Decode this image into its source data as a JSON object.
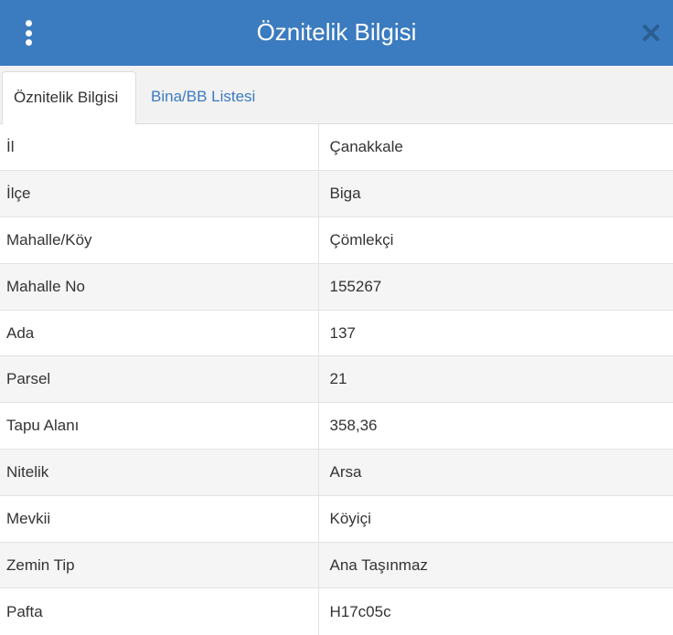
{
  "header": {
    "title": "Öznitelik Bilgisi",
    "menu_icon": "vertical-dots-icon",
    "close_icon": "close-icon",
    "background": "#3b7bbf"
  },
  "tabs": [
    {
      "label": "Öznitelik Bilgisi",
      "active": true
    },
    {
      "label": "Bina/BB Listesi",
      "active": false
    }
  ],
  "attributes": [
    {
      "key": "İl",
      "value": "Çanakkale"
    },
    {
      "key": "İlçe",
      "value": "Biga"
    },
    {
      "key": "Mahalle/Köy",
      "value": "Çömlekçi"
    },
    {
      "key": "Mahalle No",
      "value": "155267"
    },
    {
      "key": "Ada",
      "value": "137"
    },
    {
      "key": "Parsel",
      "value": "21"
    },
    {
      "key": "Tapu Alanı",
      "value": "358,36"
    },
    {
      "key": "Nitelik",
      "value": "Arsa"
    },
    {
      "key": "Mevkii",
      "value": "Köyiçi"
    },
    {
      "key": "Zemin Tip",
      "value": "Ana Taşınmaz"
    },
    {
      "key": "Pafta",
      "value": "H17c05c"
    }
  ]
}
